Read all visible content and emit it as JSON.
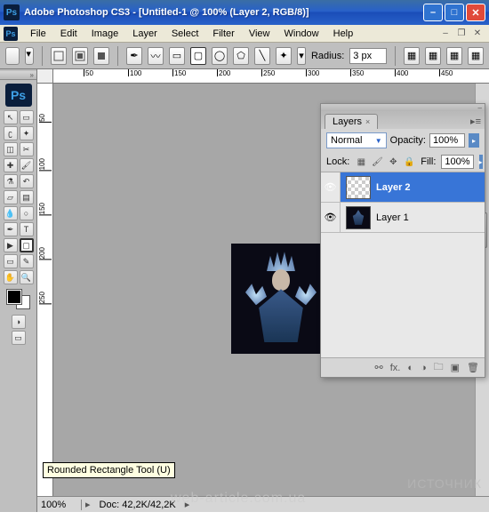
{
  "titlebar": {
    "app_icon_text": "Ps",
    "title": "Adobe Photoshop CS3 - [Untitled-1 @ 100% (Layer 2, RGB/8)]"
  },
  "menubar": {
    "app_icon_text": "Ps",
    "items": [
      "File",
      "Edit",
      "Image",
      "Layer",
      "Select",
      "Filter",
      "View",
      "Window",
      "Help"
    ]
  },
  "optionsbar": {
    "radius_label": "Radius:",
    "radius_value": "3 px"
  },
  "ruler": {
    "h_marks": [
      "50",
      "100",
      "150",
      "200",
      "250",
      "300",
      "350",
      "400",
      "450"
    ],
    "v_marks": [
      "50",
      "100",
      "150",
      "200",
      "250"
    ]
  },
  "tooltip": {
    "text": "Rounded Rectangle Tool (U)"
  },
  "layers_panel": {
    "tab_label": "Layers",
    "blend_mode": "Normal",
    "opacity_label": "Opacity:",
    "opacity_value": "100%",
    "lock_label": "Lock:",
    "fill_label": "Fill:",
    "fill_value": "100%",
    "items": [
      {
        "name": "Layer 2",
        "selected": true,
        "visible": true
      },
      {
        "name": "Layer 1",
        "selected": false,
        "visible": true
      }
    ],
    "footer_fx": "fx."
  },
  "statusbar": {
    "zoom": "100%",
    "doc": "Doc: 42,2K/42,2K"
  },
  "watermark": "ИСТОЧНИК",
  "watermark2": "web-article.com.ua"
}
